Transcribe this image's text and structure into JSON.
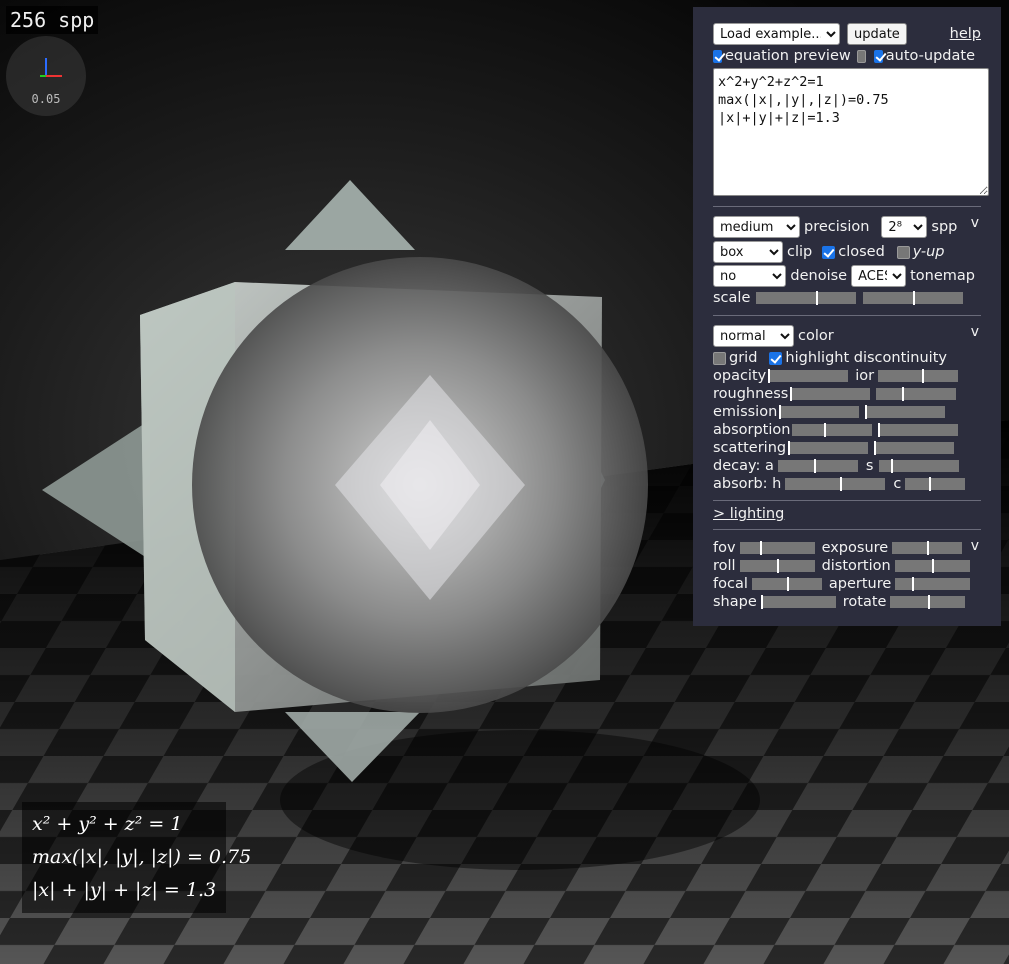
{
  "render": {
    "spp_label": "256 spp",
    "axis_scale": "0.05"
  },
  "equations_rendered": [
    "x² + y² + z² = 1",
    "max(|x|, |y|, |z|) = 0.75",
    "|x| + |y| + |z| = 1.3"
  ],
  "panel": {
    "load_example": "Load example...",
    "update_label": "update",
    "help_label": "help",
    "equation_preview_label": "equation preview",
    "auto_update_label": "auto-update",
    "equation_text": "x^2+y^2+z^2=1\nmax(|x|,|y|,|z|)=0.75\n|x|+|y|+|z|=1.3",
    "render_section": {
      "precision_value": "medium",
      "precision_label": "precision",
      "spp_value": "2⁸",
      "spp_label": "spp",
      "clip_value": "box",
      "clip_label": "clip",
      "closed_label": "closed",
      "yup_label": "y-up",
      "denoise_value": "no",
      "denoise_label": "denoise",
      "tonemap_value": "ACES",
      "tonemap_label": "tonemap",
      "scale_label": "scale",
      "collapse_label": "v"
    },
    "material_section": {
      "color_value": "normal",
      "color_label": "color",
      "grid_label": "grid",
      "highlight_label": "highlight discontinuity",
      "opacity_label": "opacity",
      "ior_label": "ior",
      "roughness_label": "roughness",
      "emission_label": "emission",
      "absorption_label": "absorption",
      "scattering_label": "scattering",
      "decay_label": "decay: a",
      "decay_s_label": "s",
      "absorb_label": "absorb: h",
      "absorb_c_label": "c",
      "collapse_label": "v"
    },
    "lighting_label": "> lighting",
    "camera_section": {
      "fov_label": "fov",
      "exposure_label": "exposure",
      "roll_label": "roll",
      "distortion_label": "distortion",
      "focal_label": "focal",
      "aperture_label": "aperture",
      "shape_label": "shape",
      "rotate_label": "rotate",
      "collapse_label": "v"
    }
  },
  "sliders": {
    "scale_a": 0.6,
    "scale_b": 0.5,
    "opacity": 0.0,
    "ior": 0.55,
    "roughness": 0.0,
    "roughness_b": 0.32,
    "emission": 0.0,
    "emission_b": 0.0,
    "absorption": 0.4,
    "absorption_b": 0.0,
    "scattering": 0.0,
    "scattering_b": 0.0,
    "decay_a": 0.45,
    "decay_s": 0.14,
    "absorb_h": 0.55,
    "absorb_c": 0.4,
    "fov": 0.27,
    "exposure": 0.5,
    "roll": 0.5,
    "distortion": 0.5,
    "focal": 0.5,
    "aperture": 0.22,
    "shape": 0.0,
    "rotate": 0.5
  }
}
